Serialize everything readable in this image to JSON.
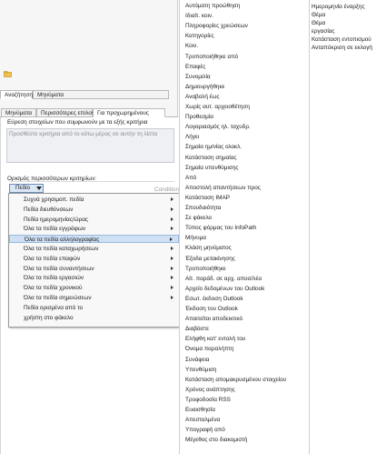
{
  "tabs": {
    "search": "Αναζήτηση",
    "messages": "Μηνύματα"
  },
  "subtabs": {
    "messages": "Μηνύματα",
    "more_options": "Περισσότερες επιλογές",
    "advanced": "Για προχωρημένους"
  },
  "advanced": {
    "find_label": "Εύρεση στοιχείων που συμφωνούν με τα εξής κριτήρια",
    "criteria_placeholder": "Προσθέστε κριτήρια από το κάτω μέρος σε αυτήν τη λίστα",
    "define_label": "Ορισμός περισσότερων κριτηρίων:",
    "field_button": "Πεδίο",
    "condition_label": "Condition"
  },
  "field_menu": [
    {
      "label": "Συχνά χρησιμοπ. πεδία",
      "submenu": true
    },
    {
      "label": "Πεδία διευθύνσεων",
      "submenu": true
    },
    {
      "label": "Πεδία ημερομηνίας/ώρας",
      "submenu": true
    },
    {
      "label": "Όλα τα πεδία εγγράφων",
      "submenu": true
    },
    {
      "label": "Όλα τα πεδία αλληλογραφίας",
      "submenu": true
    },
    {
      "label": "Όλα τα πεδία καταχωρήσεων",
      "submenu": true
    },
    {
      "label": "Όλα τα πεδία επαφών",
      "submenu": true
    },
    {
      "label": "Όλα τα πεδία συναντήσεων",
      "submenu": true
    },
    {
      "label": "Όλα τα πεδία εργασιών",
      "submenu": true
    },
    {
      "label": "Όλα τα πεδία χρονικού",
      "submenu": true
    },
    {
      "label": "Όλα τα πεδία σημειώσεων",
      "submenu": true
    },
    {
      "label": "Πεδία ορισμένα από το",
      "submenu": false
    },
    {
      "label": "χρήστη στο φάκελο",
      "submenu": false
    }
  ],
  "mail_fields": [
    "Αυτόματη προώθηση",
    "Ιδιαίτ. κοιν.",
    "Πληροφορίες χρεώσεων",
    "Κατηγορίες",
    "Κοιν.",
    "Τροποποιήθηκε από",
    "Επαφές",
    "Συνομιλία",
    "Δημιουργήθηκε",
    "Αναβολή έως",
    "Χωρίς αυτ. αρχειοθέτηση",
    "Προθεσμία",
    "Λογαριασμός ηλ. ταχυδρ.",
    "Λήγει",
    "Σημαία ημ/νίας ολοκλ.",
    "Κατάσταση σημαίας",
    "Σημαία υπενθύμισης",
    "Από",
    "Αποστολή απαντήσεων προς",
    "Κατάσταση IMAP",
    "Σπουδαιότητα",
    "Σε φάκελο",
    "Τύπος φόρμας του InfoPath",
    "Μήνυμα",
    "Κλάση μηνύματος",
    "Έξοδα μετακίνησης",
    "Τροποποιήθηκε",
    "Αίτ. παράδ. σε αρχ. αποσ/λέα",
    "Αρχείο δεδομένων του Outlook",
    "Εσωτ. έκδοση Outlook",
    "Έκδοση του Outlook",
    "Απαιτείται αποδεικτικό",
    "Διαβάστε",
    "Ελήφθη κατ' εντολή του",
    "Όνομα παραλήπτη",
    "Συνάφεια",
    "Υπενθύμιση",
    "Κατάσταση απομακρυσμένου στοιχείου",
    "Χρόνος ανάπτησης",
    "Τροφοδοσία RSS",
    "Ευαισθησία",
    "Απεσταλμένα",
    "Υπογραφή από",
    "Μέγεθος στο διακομιστή"
  ],
  "mail_fields_more": [
    "Ημερομηνία έναρξης",
    "Θέμα",
    "Θέμα",
    "εργασίας",
    "Κατάσταση εντοπισμού",
    "Ανταπόκριση σε εκλογή"
  ]
}
